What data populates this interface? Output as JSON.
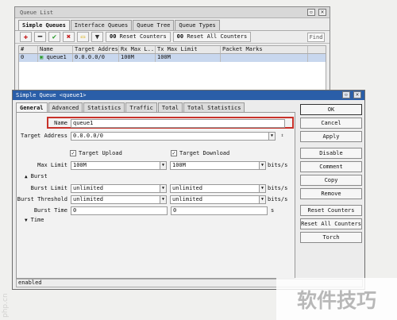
{
  "watermark": "php.cn",
  "bg_window": {
    "title": "Queue List",
    "tabs": [
      "Simple Queues",
      "Interface Queues",
      "Queue Tree",
      "Queue Types"
    ],
    "toolbar": {
      "reset_counters": "Reset Counters",
      "reset_all_counters": "Reset All Counters",
      "find": "Find",
      "counters_icon": "00"
    },
    "table": {
      "columns": [
        "#",
        "Name",
        "Target Address",
        "Rx Max L...",
        "Tx Max Limit",
        "Packet Marks"
      ],
      "rows": [
        {
          "index": "0",
          "name": "queue1",
          "target": "0.0.0.0/0",
          "rx": "100M",
          "tx": "100M",
          "marks": ""
        }
      ]
    }
  },
  "dialog": {
    "title": "Simple Queue <queue1>",
    "tabs": [
      "General",
      "Advanced",
      "Statistics",
      "Traffic",
      "Total",
      "Total Statistics"
    ],
    "name_label": "Name",
    "name_value": "queue1",
    "target_label": "Target Address",
    "target_value": "0.0.0.0/0",
    "target_upload_label": "Target Upload",
    "target_download_label": "Target Download",
    "max_limit_label": "Max Limit",
    "max_upload": "100M",
    "max_download": "100M",
    "unit": "bits/s",
    "burst_section": "Burst",
    "burst_limit_label": "Burst Limit",
    "burst_limit_up": "unlimited",
    "burst_limit_down": "unlimited",
    "burst_threshold_label": "Burst Threshold",
    "burst_threshold_up": "unlimited",
    "burst_threshold_down": "unlimited",
    "burst_time_label": "Burst Time",
    "burst_time_up": "0",
    "burst_time_down": "0",
    "seconds": "s",
    "time_section": "Time",
    "buttons": [
      "OK",
      "Cancel",
      "Apply",
      "Disable",
      "Comment",
      "Copy",
      "Remove",
      "Reset Counters",
      "Reset All Counters",
      "Torch"
    ],
    "status": "enabled"
  },
  "brand_text": "软件技巧",
  "colors": {
    "title_bar": "#2a5ea8",
    "selected_row": "#c8d7ee",
    "highlight_box": "#c8322a"
  }
}
